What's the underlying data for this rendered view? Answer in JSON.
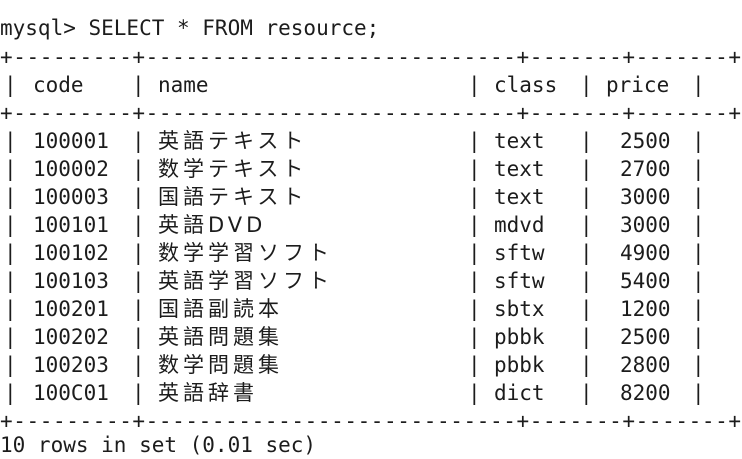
{
  "terminal": {
    "command": "mysql> SELECT * FROM resource;",
    "border": "+---------+----------------------------+-------+-------+",
    "columns": [
      "code",
      "name",
      "class",
      "price"
    ],
    "rows": [
      {
        "code": "100001",
        "name": "英語テキスト",
        "class": "text",
        "price": "2500"
      },
      {
        "code": "100002",
        "name": "数学テキスト",
        "class": "text",
        "price": "2700"
      },
      {
        "code": "100003",
        "name": "国語テキスト",
        "class": "text",
        "price": "3000"
      },
      {
        "code": "100101",
        "name": "英語DVD",
        "class": "mdvd",
        "price": "3000"
      },
      {
        "code": "100102",
        "name": "数学学習ソフト",
        "class": "sftw",
        "price": "4900"
      },
      {
        "code": "100103",
        "name": "英語学習ソフト",
        "class": "sftw",
        "price": "5400"
      },
      {
        "code": "100201",
        "name": "国語副読本",
        "class": "sbtx",
        "price": "1200"
      },
      {
        "code": "100202",
        "name": "英語問題集",
        "class": "pbbk",
        "price": "2500"
      },
      {
        "code": "100203",
        "name": "数学問題集",
        "class": "pbbk",
        "price": "2800"
      },
      {
        "code": "100C01",
        "name": "英語辞書",
        "class": "dict",
        "price": "8200"
      }
    ],
    "footer": "10 rows in set (0.01 sec)"
  }
}
